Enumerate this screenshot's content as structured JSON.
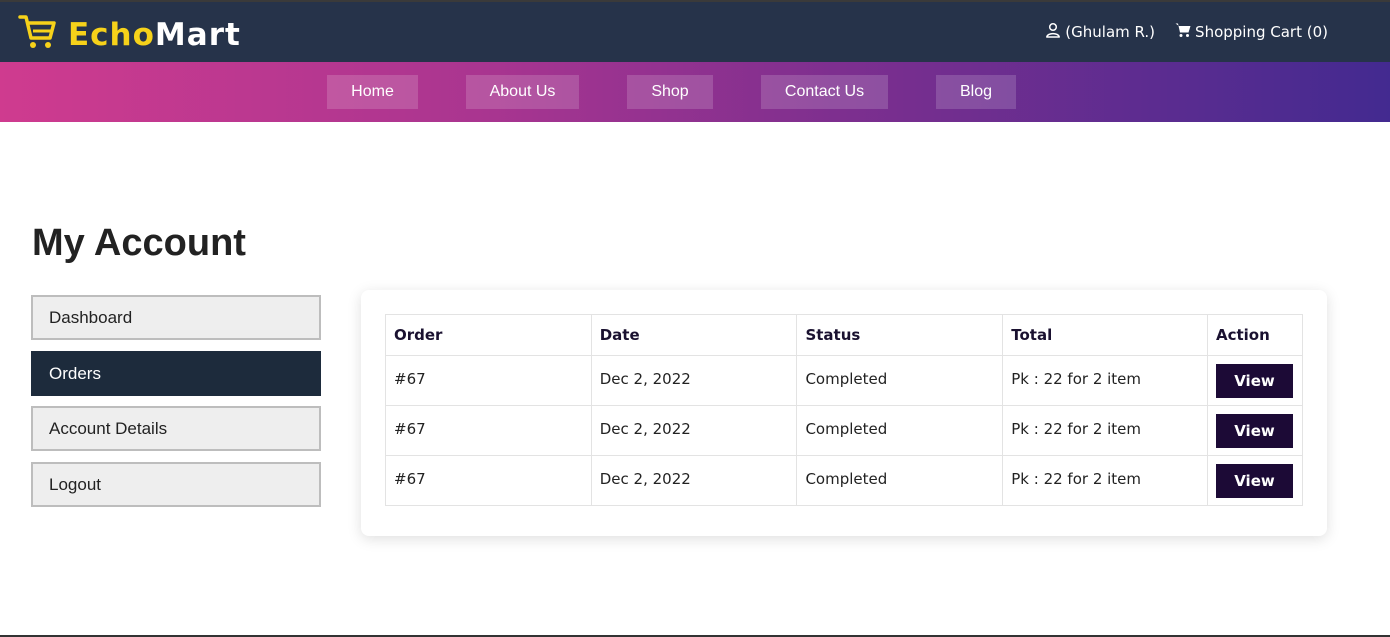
{
  "header": {
    "logo_echo": "Echo",
    "logo_mart": "Mart",
    "user_label": "(Ghulam R.)",
    "cart_label": "Shopping Cart (0)"
  },
  "nav": {
    "home": "Home",
    "about": "About Us",
    "shop": "Shop",
    "contact": "Contact Us",
    "blog": "Blog"
  },
  "page": {
    "title": "My Account"
  },
  "sidebar": {
    "items": [
      {
        "label": "Dashboard",
        "active": false
      },
      {
        "label": "Orders",
        "active": true
      },
      {
        "label": "Account Details",
        "active": false
      },
      {
        "label": "Logout",
        "active": false
      }
    ]
  },
  "orders": {
    "columns": [
      "Order",
      "Date",
      "Status",
      "Total",
      "Action"
    ],
    "rows": [
      {
        "order": "#67",
        "date": "Dec 2, 2022",
        "status": "Completed",
        "total": "Pk : 22 for 2 item",
        "action": "View"
      },
      {
        "order": "#67",
        "date": "Dec 2, 2022",
        "status": "Completed",
        "total": "Pk : 22 for 2 item",
        "action": "View"
      },
      {
        "order": "#67",
        "date": "Dec 2, 2022",
        "status": "Completed",
        "total": "Pk : 22 for 2 item",
        "action": "View"
      }
    ]
  },
  "icons": {
    "logo": "shopping-cart-icon",
    "user": "user-icon",
    "cart": "cart-icon"
  },
  "colors": {
    "header_bg": "#26334a",
    "logo_accent": "#f6d21a",
    "active_sidebar": "#1d2b3c",
    "button": "#1c0a36"
  }
}
